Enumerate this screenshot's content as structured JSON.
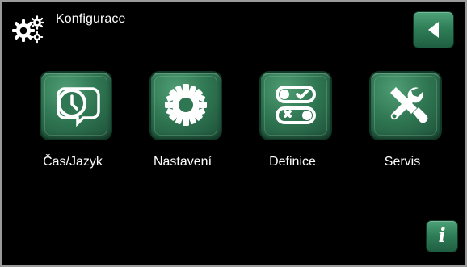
{
  "header": {
    "title": "Konfigurace",
    "title_icon": "gears-icon",
    "back_icon": "back-arrow-icon"
  },
  "tiles": [
    {
      "label": "Čas/Jazyk",
      "icon": "clock-speech-bubble-icon"
    },
    {
      "label": "Nastavení",
      "icon": "gear-icon"
    },
    {
      "label": "Definice",
      "icon": "toggle-switches-icon"
    },
    {
      "label": "Servis",
      "icon": "tools-icon"
    }
  ],
  "footer": {
    "info_label": "i",
    "info_icon": "info-icon"
  },
  "colors": {
    "background": "#000000",
    "button_green": "#2f7f58",
    "button_green_dark": "#1f5e41",
    "text": "#ffffff",
    "frame": "#9a9a9a"
  }
}
